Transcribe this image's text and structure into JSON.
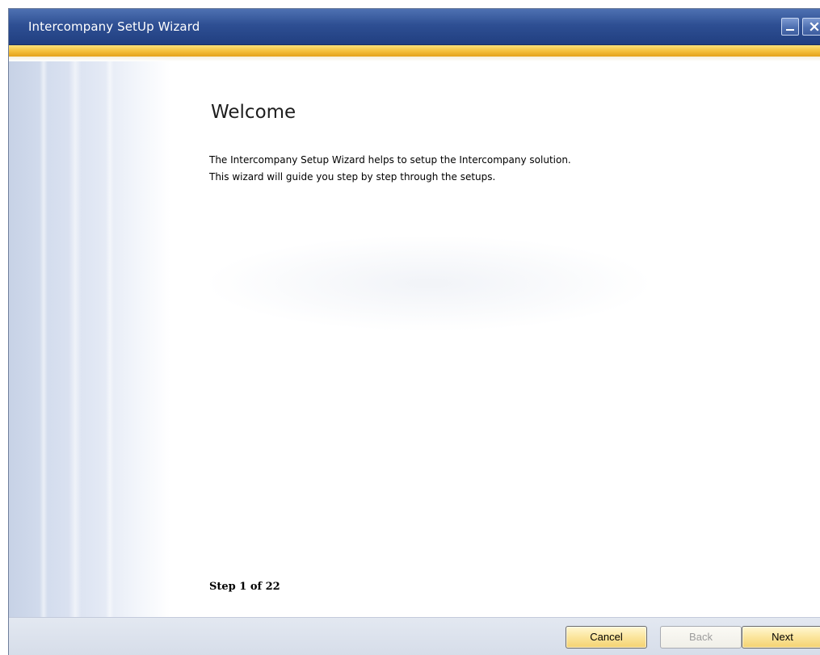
{
  "window": {
    "title": "Intercompany SetUp Wizard",
    "minimize_label": "_",
    "close_label": "X"
  },
  "page": {
    "heading": "Welcome",
    "description_lines": [
      "The Intercompany Setup Wizard helps to setup the Intercompany solution.",
      "This wizard will guide you step by step through the setups."
    ],
    "step_text": "Step 1 of 22"
  },
  "footer": {
    "cancel_label": "Cancel",
    "back_label": "Back",
    "next_label": "Next"
  },
  "colors": {
    "titlebar": "#2e4f93",
    "accent_gold": "#f5c13d",
    "button_active": "#fbe59c"
  }
}
